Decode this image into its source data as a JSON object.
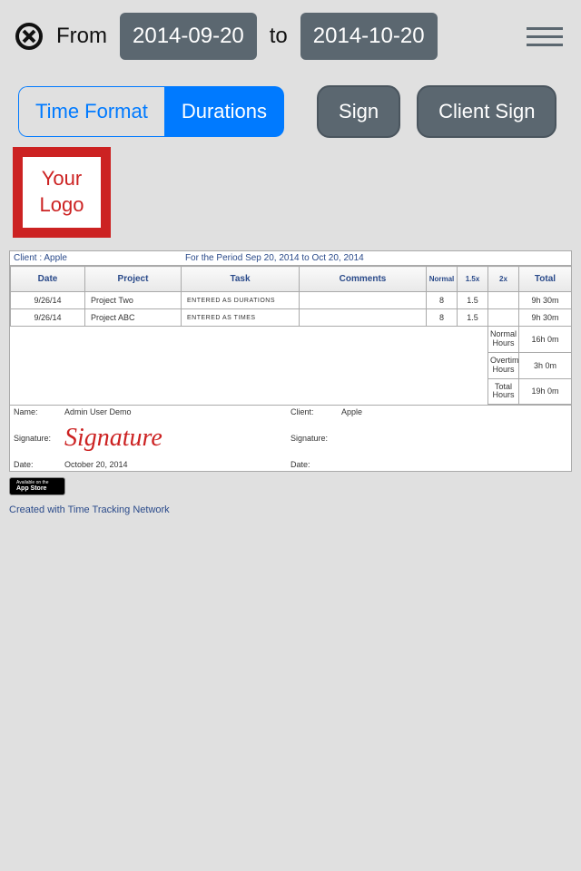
{
  "topbar": {
    "from_label": "From",
    "to_label": "to",
    "date_from": "2014-09-20",
    "date_to": "2014-10-20"
  },
  "segments": {
    "time_format": "Time Format",
    "durations": "Durations"
  },
  "actions": {
    "sign": "Sign",
    "client_sign": "Client Sign"
  },
  "logo_text": "Your\nLogo",
  "report": {
    "client_label": "Client : Apple",
    "period": "For the Period Sep 20, 2014 to Oct 20, 2014",
    "headers": {
      "date": "Date",
      "project": "Project",
      "task": "Task",
      "comments": "Comments",
      "normal": "Normal",
      "x15": "1.5x",
      "x2": "2x",
      "total": "Total"
    },
    "rows": [
      {
        "date": "9/26/14",
        "project": "Project Two",
        "task": "ENTERED AS DURATIONS",
        "comments": "",
        "normal": "8",
        "x15": "1.5",
        "x2": "",
        "total": "9h 30m"
      },
      {
        "date": "9/26/14",
        "project": "Project ABC",
        "task": "ENTERED AS TIMES",
        "comments": "",
        "normal": "8",
        "x15": "1.5",
        "x2": "",
        "total": "9h 30m"
      }
    ],
    "footers": [
      {
        "label": "Normal Hours",
        "value": "16h 0m"
      },
      {
        "label": "Overtime Hours",
        "value": "3h 0m"
      },
      {
        "label": "Total Hours",
        "value": "19h 0m"
      }
    ],
    "sig": {
      "name_k": "Name:",
      "name_v": "Admin User Demo",
      "client_k": "Client:",
      "client_v": "Apple",
      "sig_k": "Signature:",
      "sig_v": "Signature",
      "sig2_k": "Signature:",
      "date_k": "Date:",
      "date_v": "October 20, 2014",
      "date2_k": "Date:"
    }
  },
  "appstore": {
    "line1": "Available on the",
    "line2": "App Store"
  },
  "credit": "Created with Time Tracking Network"
}
